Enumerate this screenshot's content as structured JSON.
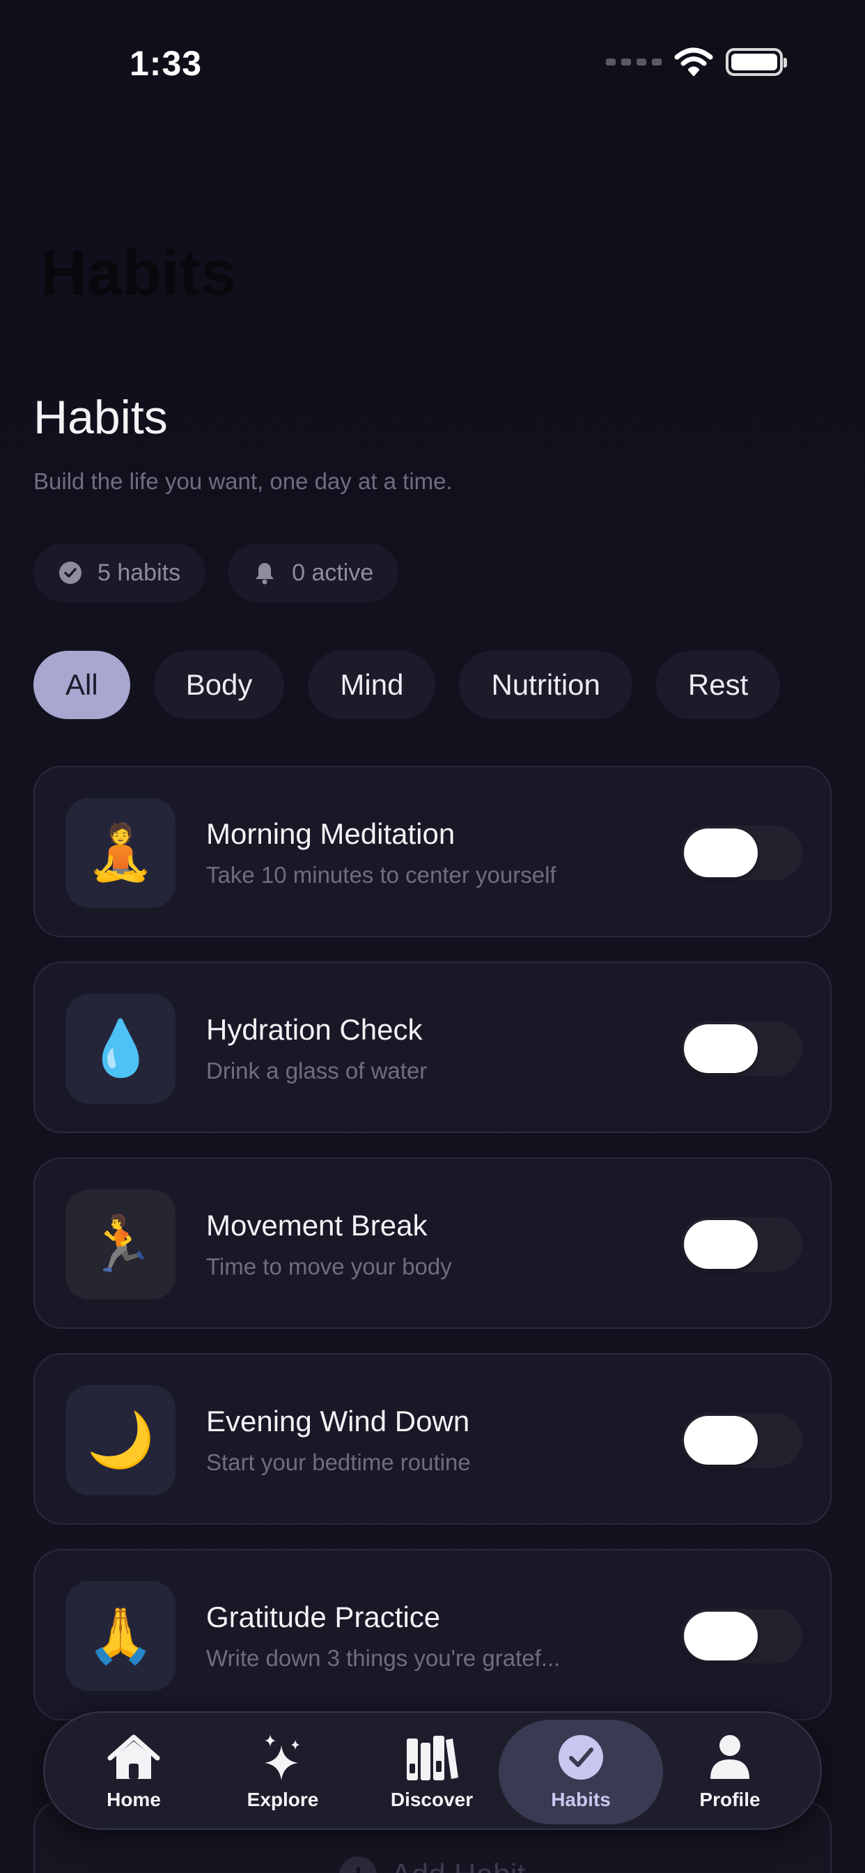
{
  "status_bar": {
    "time": "1:33"
  },
  "header": {
    "ghost_title": "Habits",
    "title": "Habits",
    "subtitle": "Build the life you want, one day at a time."
  },
  "stats": {
    "habits_count": "5 habits",
    "active_count": "0 active"
  },
  "filters": {
    "items": [
      "All",
      "Body",
      "Mind",
      "Nutrition",
      "Rest"
    ],
    "selected": "All"
  },
  "habits": [
    {
      "icon": "🧘",
      "title": "Morning Meditation",
      "description": "Take 10 minutes to center yourself",
      "enabled": false
    },
    {
      "icon": "💧",
      "title": "Hydration Check",
      "description": "Drink a glass of water",
      "enabled": false
    },
    {
      "icon": "🏃",
      "title": "Movement Break",
      "description": "Time to move your body",
      "enabled": false
    },
    {
      "icon": "🌙",
      "title": "Evening Wind Down",
      "description": "Start your bedtime routine",
      "enabled": false
    },
    {
      "icon": "🙏",
      "title": "Gratitude Practice",
      "description": "Write down 3 things you're gratef...",
      "enabled": false
    }
  ],
  "add_habit": {
    "label": "Add Habit"
  },
  "tab_bar": {
    "items": [
      {
        "label": "Home",
        "icon": "house-icon"
      },
      {
        "label": "Explore",
        "icon": "sparkles-icon"
      },
      {
        "label": "Discover",
        "icon": "books-icon"
      },
      {
        "label": "Habits",
        "icon": "checkmark-circle-icon"
      },
      {
        "label": "Profile",
        "icon": "person-icon"
      }
    ],
    "selected": "Habits"
  },
  "colors": {
    "background": "#12121f",
    "card": "#181827",
    "chip_active": "#a9a6cf",
    "accent": "#c9c7f0"
  }
}
